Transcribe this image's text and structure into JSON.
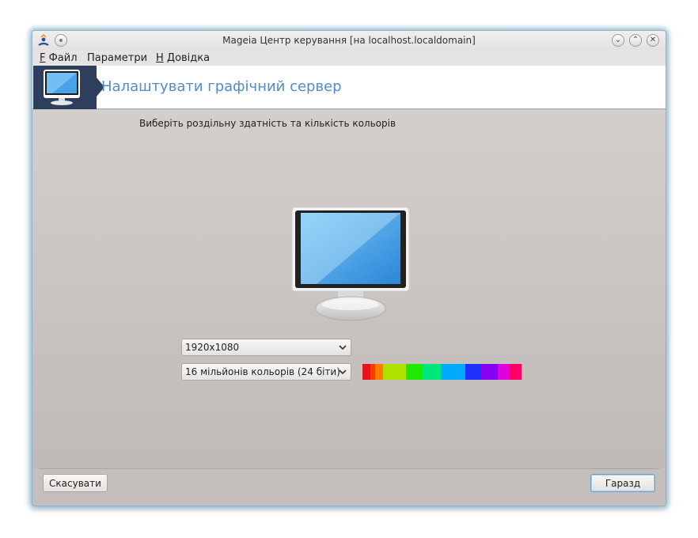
{
  "window": {
    "title": "Mageia Центр керування  [на localhost.localdomain]",
    "minimize_symbol": "⌄",
    "maximize_symbol": "⌃",
    "close_symbol": "✕"
  },
  "menu": {
    "file": {
      "mnemonic": "F",
      "label": " Файл"
    },
    "settings": {
      "label": "Параметри"
    },
    "help": {
      "mnemonic": "H",
      "label": " Довідка"
    }
  },
  "banner": {
    "title": "Налаштувати графічний сервер"
  },
  "main": {
    "instruction": "Виберіть роздільну здатність та кількість кольорів",
    "resolution_select": {
      "value": "1920x1080"
    },
    "color_depth_select": {
      "value": "16 мільйонів кольорів (24 біти)"
    },
    "color_strip_colors": [
      "#e8141c",
      "#ff3a00",
      "#ff7b00",
      "#aee000",
      "#20e800",
      "#00e87a",
      "#00aaff",
      "#2030ff",
      "#8800ee",
      "#e000e0",
      "#ff0066"
    ]
  },
  "footer": {
    "cancel_label": "Скасувати",
    "ok_label": "Гаразд"
  },
  "icons": [
    "mageia-app-icon",
    "pin-icon",
    "minimize-icon",
    "maximize-icon",
    "close-icon",
    "monitor-icon",
    "chevron-down-icon"
  ],
  "colors": {
    "banner_title": "#4f8cc9",
    "banner_icon_bg": "#2d3f5c",
    "focus_border": "#6aa3d0"
  }
}
